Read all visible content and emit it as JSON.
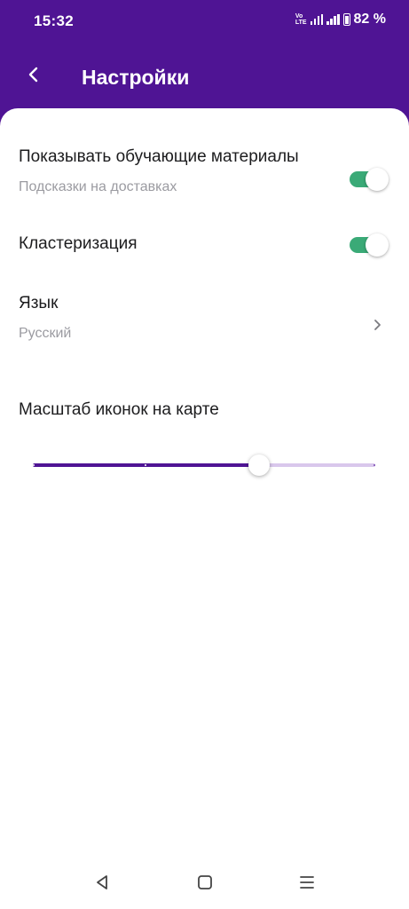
{
  "status_bar": {
    "time": "15:32",
    "network_label": "VoLTE",
    "battery_percent": "82 %",
    "battery_level": 0.82
  },
  "header": {
    "title": "Настройки",
    "back_icon": "chevron-left-icon"
  },
  "settings": {
    "tutorials": {
      "title": "Показывать обучающие материалы",
      "subtitle": "Подсказки на доставках",
      "enabled": true
    },
    "clustering": {
      "title": "Кластеризация",
      "enabled": true
    },
    "language": {
      "title": "Язык",
      "value": "Русский"
    },
    "icon_scale": {
      "title": "Масштаб иконок на карте",
      "value_fraction": 0.66,
      "steps": [
        0,
        0.33,
        0.66,
        1
      ]
    }
  },
  "colors": {
    "brand": "#4f1494",
    "toggle_on": "#3aaa77",
    "slider_inactive": "#d9c7ec"
  },
  "nav_bar": {
    "back": "triangle-back-icon",
    "home": "square-home-icon",
    "menu": "menu-icon"
  }
}
